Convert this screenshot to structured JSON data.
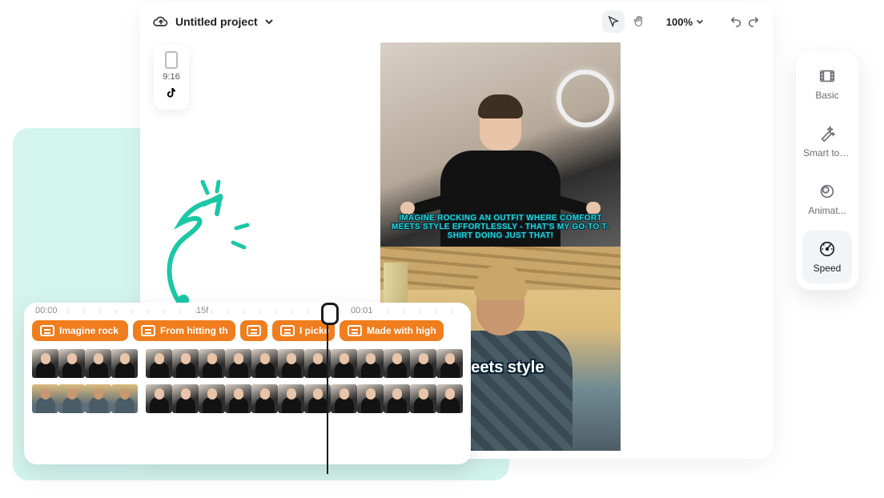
{
  "header": {
    "title": "Untitled project",
    "zoom": "100%"
  },
  "aspect": {
    "label": "9:16",
    "platform": "tiktok"
  },
  "canvas": {
    "caption_top_line1": "IMAGINE ROCKING AN OUTFIT WHERE COMFORT",
    "caption_top_line2": "MEETS STYLE EFFORTLESSLY - THAT'S MY GO-TO T-",
    "caption_top_line3": "SHIRT DOING JUST THAT!",
    "caption_bottom": "meets style"
  },
  "tools": [
    {
      "key": "basic",
      "label": "Basic",
      "icon": "film-icon"
    },
    {
      "key": "smart",
      "label": "Smart tools",
      "icon": "wand-icon"
    },
    {
      "key": "animation",
      "label": "Animat...",
      "icon": "circle-icon"
    },
    {
      "key": "speed",
      "label": "Speed",
      "icon": "gauge-icon",
      "active": true
    }
  ],
  "timeline": {
    "ruler": {
      "t0": "00:00",
      "t1": "15f",
      "t2": "00:01"
    },
    "clips": [
      {
        "label": "Imagine rock"
      },
      {
        "label": "From hitting th"
      },
      {
        "label": "",
        "iconOnly": true
      },
      {
        "label": "I picke"
      },
      {
        "label": "Made with high"
      }
    ]
  }
}
